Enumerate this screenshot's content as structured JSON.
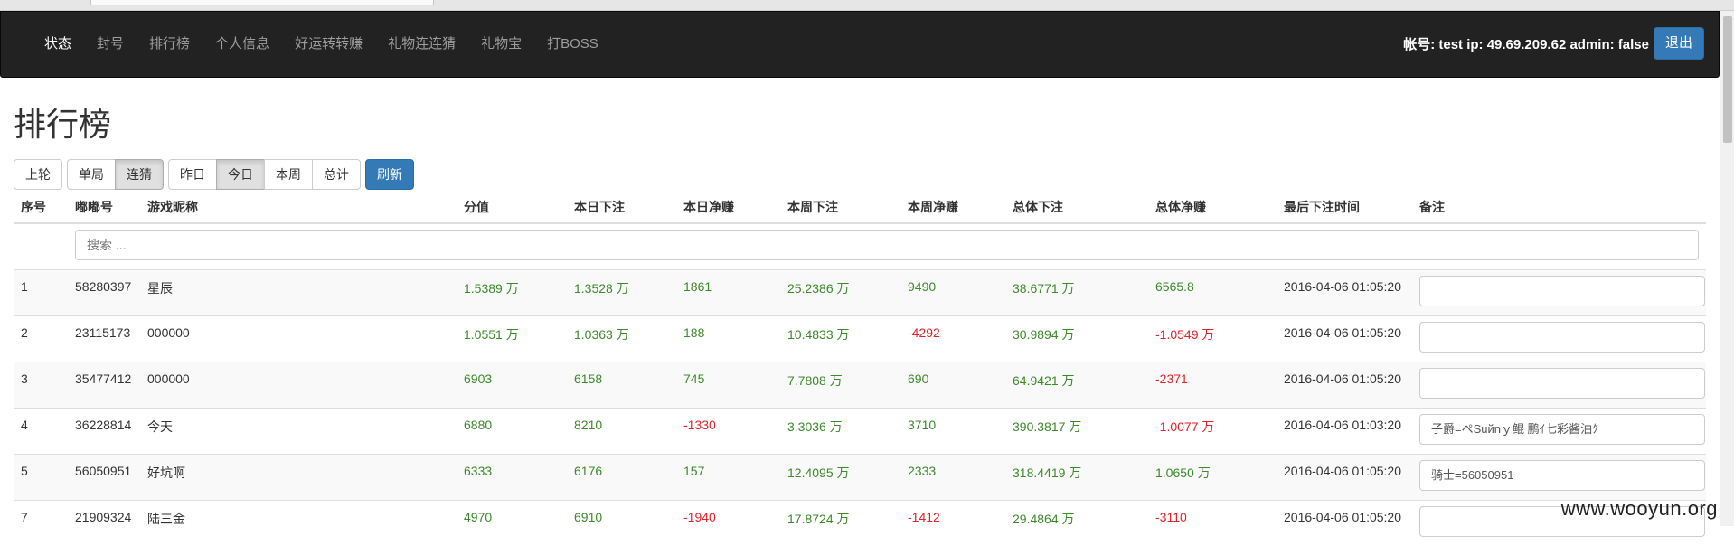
{
  "nav": {
    "items": [
      {
        "label": "状态",
        "active": true
      },
      {
        "label": "封号",
        "active": false
      },
      {
        "label": "排行榜",
        "active": false
      },
      {
        "label": "个人信息",
        "active": false
      },
      {
        "label": "好运转转赚",
        "active": false
      },
      {
        "label": "礼物连连猜",
        "active": false
      },
      {
        "label": "礼物宝",
        "active": false
      },
      {
        "label": "打BOSS",
        "active": false
      }
    ],
    "account_info": "帐号: test ip: 49.69.209.62 admin: false",
    "logout_label": "退出"
  },
  "page": {
    "title": "排行榜"
  },
  "toolbar": {
    "prev_round": "上轮",
    "single": "单局",
    "streak": "连猜",
    "yesterday": "昨日",
    "today": "今日",
    "week": "本周",
    "total": "总计",
    "refresh": "刷新",
    "active": [
      "连猜",
      "今日"
    ]
  },
  "table": {
    "headers": [
      "序号",
      "嘟嘟号",
      "游戏昵称",
      "分值",
      "本日下注",
      "本日净赚",
      "本周下注",
      "本周净赚",
      "总体下注",
      "总体净赚",
      "最后下注时间",
      "备注"
    ],
    "search_placeholder": "搜索 ...",
    "rows": [
      {
        "idx": "1",
        "id": "58280397",
        "name": "星辰",
        "score": "1.5389 万",
        "day_bet": "1.3528 万",
        "day_net": "1861",
        "week_bet": "25.2386 万",
        "week_net": "9490",
        "total_bet": "38.6771 万",
        "total_net": "6565.8",
        "last_time": "2016-04-06 01:05:20",
        "note": ""
      },
      {
        "idx": "2",
        "id": "23115173",
        "name": "000000",
        "score": "1.0551 万",
        "day_bet": "1.0363 万",
        "day_net": "188",
        "week_bet": "10.4833 万",
        "week_net": "-4292",
        "total_bet": "30.9894 万",
        "total_net": "-1.0549 万",
        "last_time": "2016-04-06 01:05:20",
        "note": ""
      },
      {
        "idx": "3",
        "id": "35477412",
        "name": "000000",
        "score": "6903",
        "day_bet": "6158",
        "day_net": "745",
        "week_bet": "7.7808 万",
        "week_net": "690",
        "total_bet": "64.9421 万",
        "total_net": "-2371",
        "last_time": "2016-04-06 01:05:20",
        "note": ""
      },
      {
        "idx": "4",
        "id": "36228814",
        "name": "今天",
        "score": "6880",
        "day_bet": "8210",
        "day_net": "-1330",
        "week_bet": "3.3036 万",
        "week_net": "3710",
        "total_bet": "390.3817 万",
        "total_net": "-1.0077 万",
        "last_time": "2016-04-06 01:03:20",
        "note": "子爵=ぺSuйnｙ鲲 鹏ｲ七彩酱油ｸ"
      },
      {
        "idx": "5",
        "id": "56050951",
        "name": "好坑啊",
        "score": "6333",
        "day_bet": "6176",
        "day_net": "157",
        "week_bet": "12.4095 万",
        "week_net": "2333",
        "total_bet": "318.4419 万",
        "total_net": "1.0650 万",
        "last_time": "2016-04-06 01:05:20",
        "note": "骑士=56050951"
      },
      {
        "idx": "7",
        "id": "21909324",
        "name": "陆三金",
        "score": "4970",
        "day_bet": "6910",
        "day_net": "-1940",
        "week_bet": "17.8724 万",
        "week_net": "-1412",
        "total_bet": "29.4864 万",
        "total_net": "-3110",
        "last_time": "2016-04-06 01:05:20",
        "note": ""
      }
    ]
  },
  "colors": {
    "positive": "#3c8a2a",
    "negative": "#e0222a",
    "primary": "#337ab7",
    "navbar": "#222222"
  },
  "watermark": "www.wooyun.org"
}
